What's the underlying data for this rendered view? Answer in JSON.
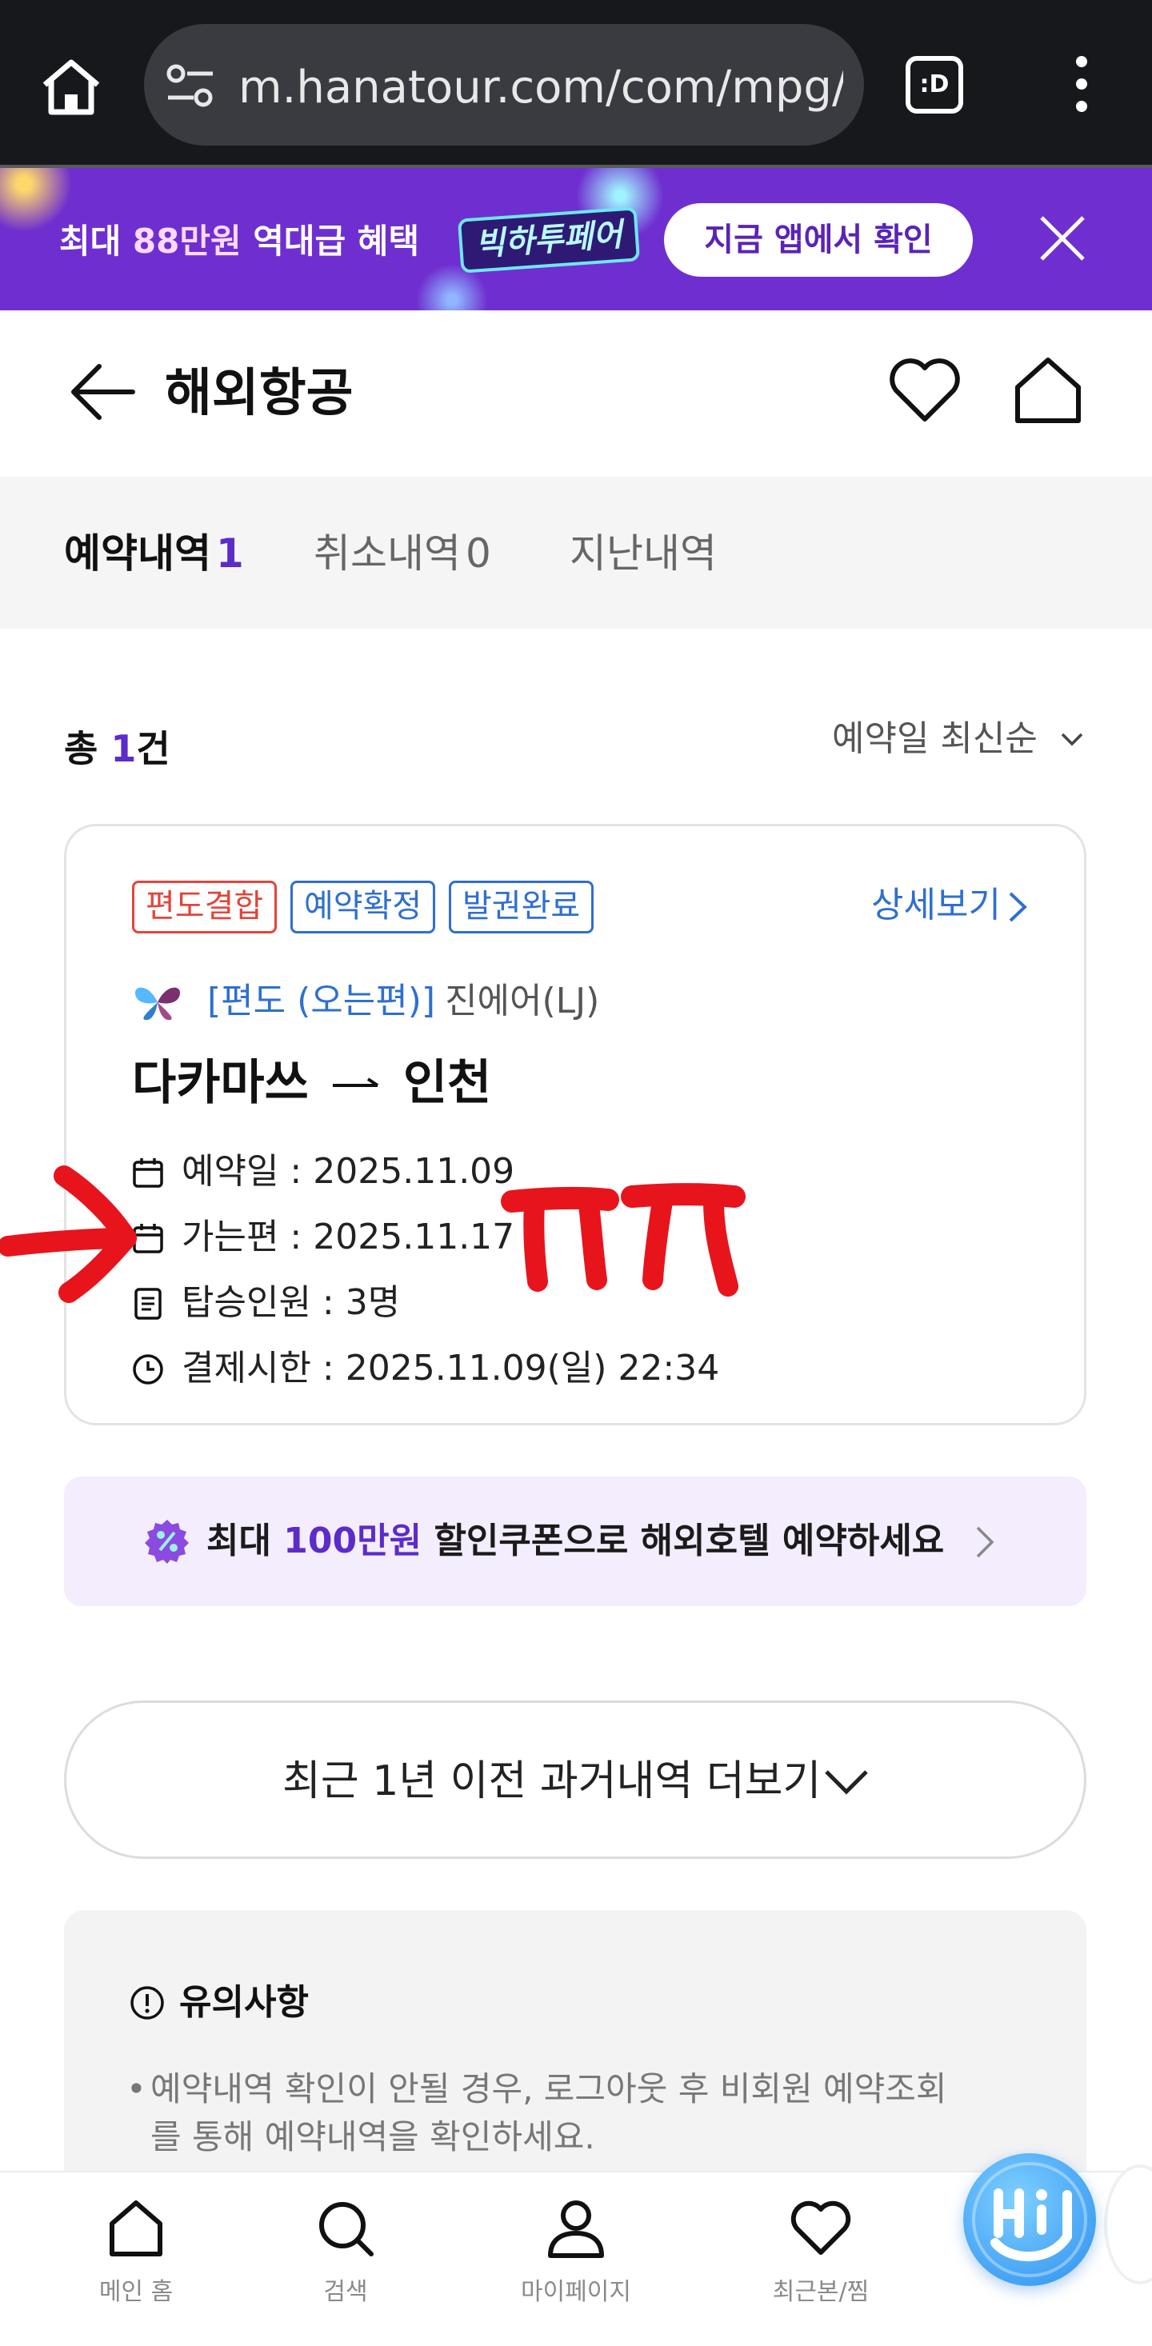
{
  "browser": {
    "url": "m.hanatour.com/com/mpg/C",
    "tab_label": ":D"
  },
  "promo": {
    "text_prefix": "최대",
    "text_highlight": "88만원",
    "text_suffix": "역대급 혜택",
    "badge": "빅하투페어",
    "cta": "지금 앱에서 확인"
  },
  "header": {
    "title": "해외항공"
  },
  "tabs": [
    {
      "label": "예약내역",
      "count": "1",
      "active": true
    },
    {
      "label": "취소내역",
      "count": "0",
      "active": false
    },
    {
      "label": "지난내역",
      "count": "",
      "active": false
    }
  ],
  "summary": {
    "total_prefix": "총",
    "total_count": "1",
    "total_suffix": "건",
    "sort_label": "예약일 최신순"
  },
  "reservation": {
    "tags": [
      "편도결합",
      "예약확정",
      "발권완료"
    ],
    "detail_link": "상세보기",
    "segment": "[편도 (오는편)]",
    "airline": "진에어(LJ)",
    "origin": "다카마쓰",
    "destination": "인천",
    "booking_date": "예약일 : 2025.11.09",
    "departure_date": "가는편 : 2025.11.17",
    "passengers": "탑승인원 : 3명",
    "payment_deadline": "결제시한 : 2025.11.09(일) 22:34"
  },
  "coupon": {
    "prefix": "최대",
    "highlight": "100만원",
    "suffix": "할인쿠폰으로 해외호텔 예약하세요"
  },
  "more_history": {
    "label": "최근 1년 이전 과거내역 더보기"
  },
  "notice": {
    "title": "유의사항",
    "text": "예약내역 확인이 안될 경우, 로그아웃 후 비회원 예약조회를 통해 예약내역을 확인하세요."
  },
  "bottom_nav": [
    {
      "label": "메인 홈",
      "icon": "home-icon"
    },
    {
      "label": "검색",
      "icon": "search-icon"
    },
    {
      "label": "마이페이지",
      "icon": "person-icon"
    },
    {
      "label": "최근본/찜",
      "icon": "heart-icon"
    }
  ],
  "colors": {
    "accent": "#5b2cc9",
    "promo_bg": "#6f2fd0",
    "tag_red": "#e2453c",
    "tag_blue": "#2f6fd0",
    "annotation": "#e8141c"
  }
}
